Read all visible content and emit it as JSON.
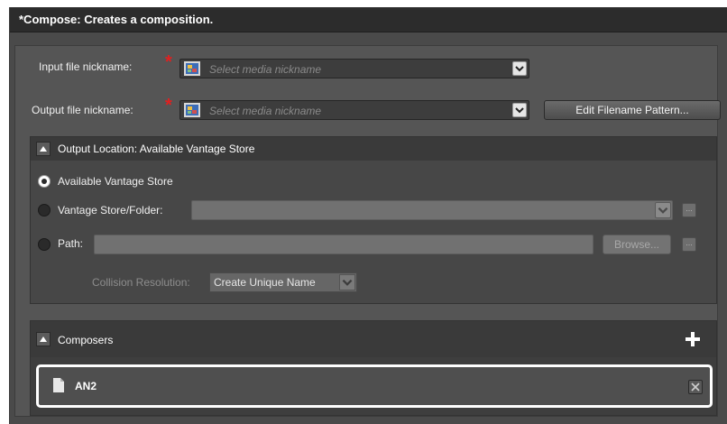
{
  "window": {
    "title": "*Compose: Creates a composition."
  },
  "form": {
    "input_label": "Input file nickname:",
    "output_label": "Output file nickname:",
    "select_placeholder": "Select media nickname",
    "edit_filename_pattern": "Edit Filename Pattern..."
  },
  "output_location": {
    "header": "Output Location: Available Vantage Store",
    "opt_available": "Available Vantage Store",
    "opt_store_folder": "Vantage Store/Folder:",
    "opt_path": "Path:",
    "browse": "Browse...",
    "collision_label": "Collision Resolution:",
    "collision_value": "Create Unique Name"
  },
  "composers": {
    "header": "Composers",
    "items": [
      {
        "label": "AN2"
      }
    ]
  }
}
